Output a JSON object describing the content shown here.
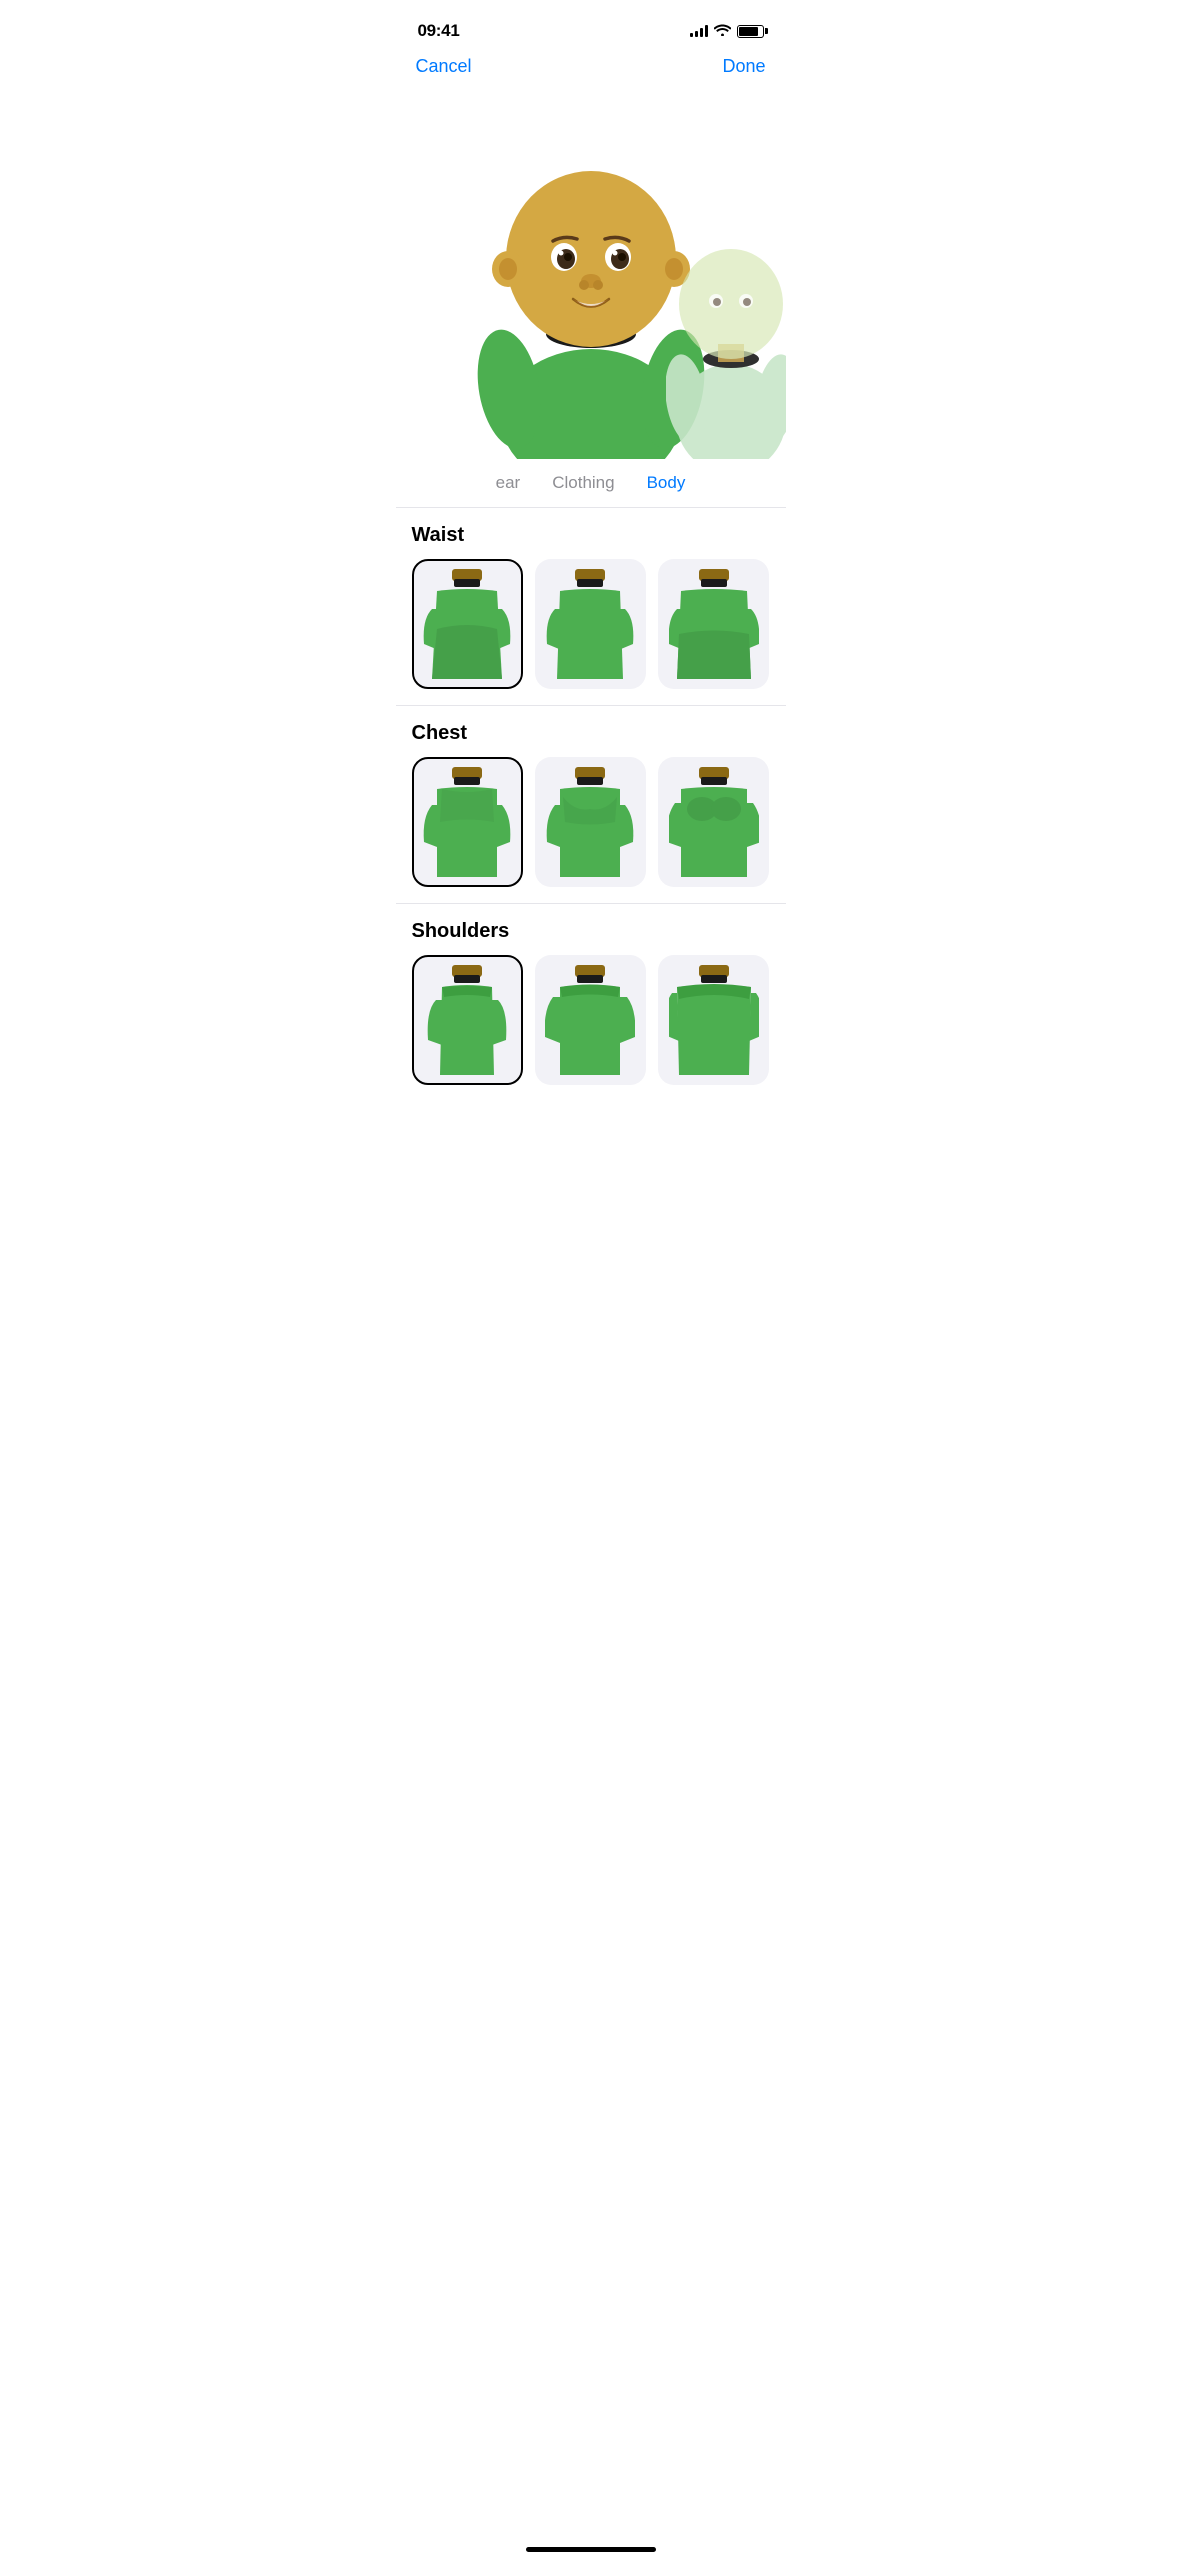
{
  "statusBar": {
    "time": "09:41",
    "signalBars": [
      4,
      6,
      8,
      10,
      12
    ],
    "battery": 85
  },
  "nav": {
    "cancelLabel": "Cancel",
    "doneLabel": "Done"
  },
  "tabs": {
    "partial": "ear",
    "items": [
      {
        "id": "clothing",
        "label": "Clothing",
        "active": false
      },
      {
        "id": "body",
        "label": "Body",
        "active": true
      }
    ]
  },
  "sections": [
    {
      "id": "waist",
      "title": "Waist",
      "options": [
        {
          "id": "waist-1",
          "selected": true
        },
        {
          "id": "waist-2",
          "selected": false
        },
        {
          "id": "waist-3",
          "selected": false
        }
      ]
    },
    {
      "id": "chest",
      "title": "Chest",
      "options": [
        {
          "id": "chest-1",
          "selected": true
        },
        {
          "id": "chest-2",
          "selected": false
        },
        {
          "id": "chest-3",
          "selected": false
        }
      ]
    },
    {
      "id": "shoulders",
      "title": "Shoulders",
      "options": [
        {
          "id": "shoulders-1",
          "selected": true
        },
        {
          "id": "shoulders-2",
          "selected": false
        },
        {
          "id": "shoulders-3",
          "selected": false
        }
      ]
    }
  ],
  "colors": {
    "accent": "#007AFF",
    "green": "#4CAF50",
    "darkGreen": "#3d9e40",
    "collar": "#1a1a1a",
    "collarBrown": "#8B6914",
    "bodyBg": "#f2f2f7"
  }
}
